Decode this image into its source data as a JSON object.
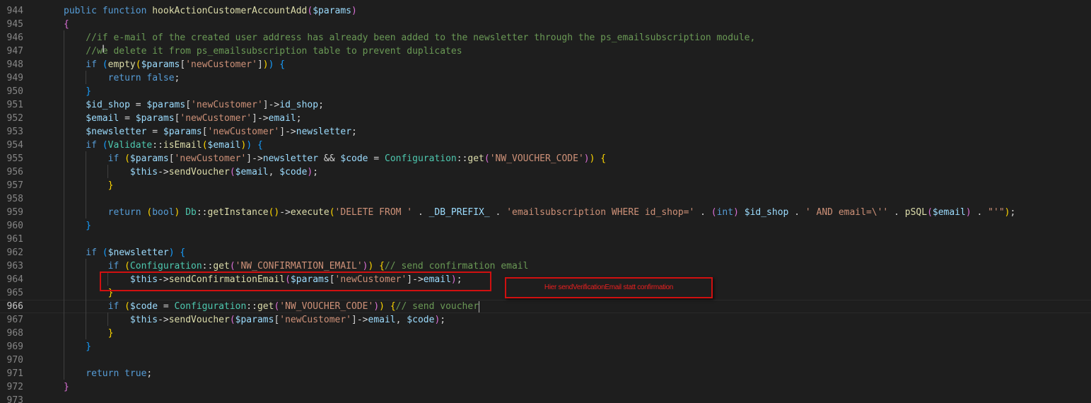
{
  "editor": {
    "language": "php",
    "current_line": 966,
    "lines": [
      {
        "n": "944",
        "tokens": [
          [
            "kw",
            "public function "
          ],
          [
            "fn",
            "hookActionCustomerAccountAdd"
          ],
          [
            "br1",
            "("
          ],
          [
            "var",
            "$params"
          ],
          [
            "br1",
            ")"
          ]
        ]
      },
      {
        "n": "945",
        "tokens": [
          [
            "br1",
            "{"
          ]
        ]
      },
      {
        "n": "946",
        "tokens": [
          [
            "cmt",
            "    //if e-mail of the created user address has already been added to the newsletter through the ps_emailsubscription module,"
          ]
        ]
      },
      {
        "n": "947",
        "tokens": [
          [
            "cmt",
            "    //we delete it from ps_emailsubscription table to prevent duplicates"
          ]
        ]
      },
      {
        "n": "948",
        "tokens": [
          [
            "kw",
            "    if "
          ],
          [
            "br2",
            "("
          ],
          [
            "fn",
            "empty"
          ],
          [
            "br3",
            "("
          ],
          [
            "var",
            "$params"
          ],
          [
            "pl",
            "["
          ],
          [
            "str",
            "'newCustomer'"
          ],
          [
            "pl",
            "]"
          ],
          [
            "br3",
            ")"
          ],
          [
            "br2",
            ")"
          ],
          [
            "pl",
            " "
          ],
          [
            "br2",
            "{"
          ]
        ]
      },
      {
        "n": "949",
        "tokens": [
          [
            "kw",
            "        return false"
          ],
          [
            "pl",
            ";"
          ]
        ]
      },
      {
        "n": "950",
        "tokens": [
          [
            "br2",
            "    }"
          ]
        ]
      },
      {
        "n": "951",
        "tokens": [
          [
            "var",
            "    $id_shop"
          ],
          [
            "pl",
            " = "
          ],
          [
            "var",
            "$params"
          ],
          [
            "pl",
            "["
          ],
          [
            "str",
            "'newCustomer'"
          ],
          [
            "pl",
            "]->"
          ],
          [
            "var",
            "id_shop"
          ],
          [
            "pl",
            ";"
          ]
        ]
      },
      {
        "n": "952",
        "tokens": [
          [
            "var",
            "    $email"
          ],
          [
            "pl",
            " = "
          ],
          [
            "var",
            "$params"
          ],
          [
            "pl",
            "["
          ],
          [
            "str",
            "'newCustomer'"
          ],
          [
            "pl",
            "]->"
          ],
          [
            "var",
            "email"
          ],
          [
            "pl",
            ";"
          ]
        ]
      },
      {
        "n": "953",
        "tokens": [
          [
            "var",
            "    $newsletter"
          ],
          [
            "pl",
            " = "
          ],
          [
            "var",
            "$params"
          ],
          [
            "pl",
            "["
          ],
          [
            "str",
            "'newCustomer'"
          ],
          [
            "pl",
            "]->"
          ],
          [
            "var",
            "newsletter"
          ],
          [
            "pl",
            ";"
          ]
        ]
      },
      {
        "n": "954",
        "tokens": [
          [
            "kw",
            "    if "
          ],
          [
            "br2",
            "("
          ],
          [
            "cls",
            "Validate"
          ],
          [
            "pl",
            "::"
          ],
          [
            "fn",
            "isEmail"
          ],
          [
            "br3",
            "("
          ],
          [
            "var",
            "$email"
          ],
          [
            "br3",
            ")"
          ],
          [
            "br2",
            ")"
          ],
          [
            "pl",
            " "
          ],
          [
            "br2",
            "{"
          ]
        ]
      },
      {
        "n": "955",
        "tokens": [
          [
            "kw",
            "        if "
          ],
          [
            "br3",
            "("
          ],
          [
            "var",
            "$params"
          ],
          [
            "pl",
            "["
          ],
          [
            "str",
            "'newCustomer'"
          ],
          [
            "pl",
            "]->"
          ],
          [
            "var",
            "newsletter"
          ],
          [
            "pl",
            " && "
          ],
          [
            "var",
            "$code"
          ],
          [
            "pl",
            " = "
          ],
          [
            "cls",
            "Configuration"
          ],
          [
            "pl",
            "::"
          ],
          [
            "fn",
            "get"
          ],
          [
            "br1",
            "("
          ],
          [
            "str",
            "'NW_VOUCHER_CODE'"
          ],
          [
            "br1",
            ")"
          ],
          [
            "br3",
            ")"
          ],
          [
            "pl",
            " "
          ],
          [
            "br3",
            "{"
          ]
        ]
      },
      {
        "n": "956",
        "tokens": [
          [
            "var",
            "            $this"
          ],
          [
            "pl",
            "->"
          ],
          [
            "fn",
            "sendVoucher"
          ],
          [
            "br1",
            "("
          ],
          [
            "var",
            "$email"
          ],
          [
            "pl",
            ", "
          ],
          [
            "var",
            "$code"
          ],
          [
            "br1",
            ")"
          ],
          [
            "pl",
            ";"
          ]
        ]
      },
      {
        "n": "957",
        "tokens": [
          [
            "br3",
            "        }"
          ]
        ]
      },
      {
        "n": "958",
        "tokens": []
      },
      {
        "n": "959",
        "tokens": [
          [
            "kw",
            "        return "
          ],
          [
            "br3",
            "("
          ],
          [
            "kw",
            "bool"
          ],
          [
            "br3",
            ")"
          ],
          [
            "pl",
            " "
          ],
          [
            "cls",
            "Db"
          ],
          [
            "pl",
            "::"
          ],
          [
            "fn",
            "getInstance"
          ],
          [
            "br3",
            "()"
          ],
          [
            "pl",
            "->"
          ],
          [
            "fn",
            "execute"
          ],
          [
            "br3",
            "("
          ],
          [
            "str",
            "'DELETE FROM '"
          ],
          [
            "pl",
            " . "
          ],
          [
            "var",
            "_DB_PREFIX_"
          ],
          [
            "pl",
            " . "
          ],
          [
            "str",
            "'emailsubscription WHERE id_shop='"
          ],
          [
            "pl",
            " . "
          ],
          [
            "br1",
            "("
          ],
          [
            "kw",
            "int"
          ],
          [
            "br1",
            ")"
          ],
          [
            "pl",
            " "
          ],
          [
            "var",
            "$id_shop"
          ],
          [
            "pl",
            " . "
          ],
          [
            "str",
            "' AND email=\\''"
          ],
          [
            "pl",
            " . "
          ],
          [
            "fn",
            "pSQL"
          ],
          [
            "br1",
            "("
          ],
          [
            "var",
            "$email"
          ],
          [
            "br1",
            ")"
          ],
          [
            "pl",
            " . "
          ],
          [
            "str",
            "\"'\""
          ],
          [
            "br3",
            ")"
          ],
          [
            "pl",
            ";"
          ]
        ]
      },
      {
        "n": "960",
        "tokens": [
          [
            "br2",
            "    }"
          ]
        ]
      },
      {
        "n": "961",
        "tokens": []
      },
      {
        "n": "962",
        "tokens": [
          [
            "kw",
            "    if "
          ],
          [
            "br2",
            "("
          ],
          [
            "var",
            "$newsletter"
          ],
          [
            "br2",
            ")"
          ],
          [
            "pl",
            " "
          ],
          [
            "br2",
            "{"
          ]
        ]
      },
      {
        "n": "963",
        "tokens": [
          [
            "kw",
            "        if "
          ],
          [
            "br3",
            "("
          ],
          [
            "cls",
            "Configuration"
          ],
          [
            "pl",
            "::"
          ],
          [
            "fn",
            "get"
          ],
          [
            "br1",
            "("
          ],
          [
            "str",
            "'NW_CONFIRMATION_EMAIL'"
          ],
          [
            "br1",
            ")"
          ],
          [
            "br3",
            ")"
          ],
          [
            "pl",
            " "
          ],
          [
            "br3",
            "{"
          ],
          [
            "cmt",
            "// send confirmation email"
          ]
        ]
      },
      {
        "n": "964",
        "tokens": [
          [
            "var",
            "            $this"
          ],
          [
            "pl",
            "->"
          ],
          [
            "fn",
            "sendConfirmationEmail"
          ],
          [
            "br1",
            "("
          ],
          [
            "var",
            "$params"
          ],
          [
            "pl",
            "["
          ],
          [
            "str",
            "'newCustomer'"
          ],
          [
            "pl",
            "]->"
          ],
          [
            "var",
            "email"
          ],
          [
            "br1",
            ")"
          ],
          [
            "pl",
            ";"
          ]
        ]
      },
      {
        "n": "965",
        "tokens": [
          [
            "br3",
            "        }"
          ]
        ]
      },
      {
        "n": "966",
        "tokens": [
          [
            "kw",
            "        if "
          ],
          [
            "br3",
            "("
          ],
          [
            "var",
            "$code"
          ],
          [
            "pl",
            " = "
          ],
          [
            "cls",
            "Configuration"
          ],
          [
            "pl",
            "::"
          ],
          [
            "fn",
            "get"
          ],
          [
            "br1",
            "("
          ],
          [
            "str",
            "'NW_VOUCHER_CODE'"
          ],
          [
            "br1",
            ")"
          ],
          [
            "br3",
            ")"
          ],
          [
            "pl",
            " "
          ],
          [
            "br3",
            "{"
          ],
          [
            "cmt",
            "// send voucher"
          ]
        ]
      },
      {
        "n": "967",
        "tokens": [
          [
            "var",
            "            $this"
          ],
          [
            "pl",
            "->"
          ],
          [
            "fn",
            "sendVoucher"
          ],
          [
            "br1",
            "("
          ],
          [
            "var",
            "$params"
          ],
          [
            "pl",
            "["
          ],
          [
            "str",
            "'newCustomer'"
          ],
          [
            "pl",
            "]->"
          ],
          [
            "var",
            "email"
          ],
          [
            "pl",
            ", "
          ],
          [
            "var",
            "$code"
          ],
          [
            "br1",
            ")"
          ],
          [
            "pl",
            ";"
          ]
        ]
      },
      {
        "n": "968",
        "tokens": [
          [
            "br3",
            "        }"
          ]
        ]
      },
      {
        "n": "969",
        "tokens": [
          [
            "br2",
            "    }"
          ]
        ]
      },
      {
        "n": "970",
        "tokens": []
      },
      {
        "n": "971",
        "tokens": [
          [
            "kw",
            "    return true"
          ],
          [
            "pl",
            ";"
          ]
        ]
      },
      {
        "n": "972",
        "tokens": [
          [
            "br1",
            "}"
          ]
        ]
      },
      {
        "n": "973",
        "tokens": []
      }
    ]
  },
  "annotation": {
    "text": "Hier sendVerificationEmail statt confirmation"
  },
  "colors": {
    "background": "#1e1e1e",
    "annotation_red": "#d01010"
  }
}
